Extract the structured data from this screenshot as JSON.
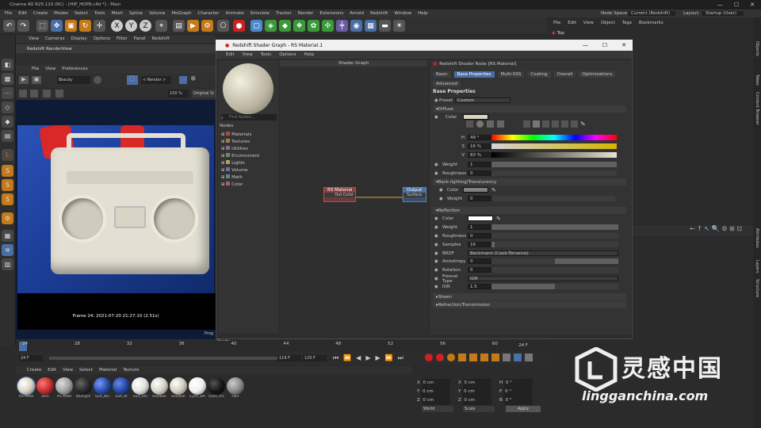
{
  "window": {
    "title": "Cinema 4D R25.110 (RC) - [HIP_HOP8.c4d *] - Main"
  },
  "menu": [
    "File",
    "Edit",
    "Create",
    "Modes",
    "Select",
    "Tools",
    "Mesh",
    "Spline",
    "Volume",
    "MoGraph",
    "Character",
    "Animate",
    "Simulate",
    "Tracker",
    "Render",
    "Extensions",
    "Arnold",
    "Redshift",
    "Window",
    "Help"
  ],
  "node_space": {
    "label": "Node Space:",
    "value": "Current (Redshift)"
  },
  "layout": {
    "label": "Layout:",
    "value": "Startup (User)"
  },
  "viewport_menu": [
    "View",
    "Cameras",
    "Display",
    "Options",
    "Filter",
    "Panel",
    "Redshift"
  ],
  "renderview": {
    "title": "Redshift RenderView",
    "menu": [
      "File",
      "View",
      "Preferences"
    ],
    "aov": "Beauty",
    "render_select": "< Render >",
    "zoom": "150 %",
    "original_size": "Original Si",
    "frame_info": "Frame  24:  2021-07-20  21:27:10  (2.51s)",
    "progress": "Prog"
  },
  "shader_graph": {
    "title": "Redshift Shader Graph - RS Material.1",
    "menu": [
      "Edit",
      "View",
      "Tools",
      "Options",
      "Help"
    ],
    "graph_title": "Shader Graph",
    "find_placeholder": "Find Nodes...",
    "nodes_label": "Nodes",
    "node_categories": [
      {
        "name": "Materials",
        "color": "#a05050"
      },
      {
        "name": "Textures",
        "color": "#a08040"
      },
      {
        "name": "Utilities",
        "color": "#8a6a9a"
      },
      {
        "name": "Environment",
        "color": "#6a8a6a"
      },
      {
        "name": "Lights",
        "color": "#b0a060"
      },
      {
        "name": "Volume",
        "color": "#7070a0"
      },
      {
        "name": "Math",
        "color": "#5a8a8a"
      },
      {
        "name": "Color",
        "color": "#a06070"
      }
    ],
    "node_rs": {
      "title": "RS Material",
      "port": "Out Color"
    },
    "node_out": {
      "title": "Output",
      "port": "Surface"
    },
    "status": "Ready"
  },
  "shader_node": {
    "title": "Redshift Shader Node [RS Material]",
    "tabs": [
      "Basic",
      "Base Properties",
      "Multi-SSS",
      "Coating",
      "Overall",
      "Optimizations",
      "Advanced"
    ],
    "active_tab": "Base Properties",
    "section_title": "Base Properties",
    "preset_label": "Preset",
    "preset_value": "Custom",
    "diffuse": "Diffuse",
    "color_label": "Color",
    "h": {
      "label": "H",
      "value": "49 °"
    },
    "s": {
      "label": "S",
      "value": "16 %"
    },
    "v": {
      "label": "V",
      "value": "83 %"
    },
    "weight": {
      "label": "Weight",
      "value": "1"
    },
    "roughness": {
      "label": "Roughness",
      "value": "0"
    },
    "backlighting": "Back-lighting/Translucency",
    "bl_color": "Color",
    "bl_weight": {
      "label": "Weight",
      "value": "0"
    },
    "reflection": "Reflection",
    "refl_color": "Color",
    "refl_weight": {
      "label": "Weight",
      "value": "1"
    },
    "refl_roughness": {
      "label": "Roughness",
      "value": "0"
    },
    "samples": {
      "label": "Samples",
      "value": "16"
    },
    "brdf": {
      "label": "BRDF",
      "value": "Beckmann (Cook-Torrance)"
    },
    "anisotropy": {
      "label": "Anisotropy",
      "value": "0"
    },
    "rotation": {
      "label": "Rotation",
      "value": "0"
    },
    "fresnel": {
      "label": "Fresnel Type",
      "value": "IOR"
    },
    "ior": {
      "label": "IOR",
      "value": "1.5"
    },
    "sheen": "Sheen",
    "refraction": "Refraction/Transmission"
  },
  "object_manager": {
    "menu": [
      "File",
      "Edit",
      "View",
      "Object",
      "Tags",
      "Bookmarks"
    ],
    "top_item": "Top"
  },
  "right_tabs": [
    "Objects",
    "Takes",
    "Content Browser",
    "Attributes",
    "Layers",
    "Structure"
  ],
  "timeline": {
    "ticks": [
      "24",
      "28",
      "32",
      "36",
      "40",
      "44",
      "48",
      "52",
      "56",
      "60"
    ],
    "current": "24 F",
    "start": "24 F",
    "end_a": "119 F",
    "end_b": "120 F",
    "right_frame": "24 F"
  },
  "material_menu": [
    "Create",
    "Edit",
    "View",
    "Select",
    "Material",
    "Texture"
  ],
  "materials": [
    {
      "name": "RS Mate",
      "color": "#d8d4c2"
    },
    {
      "name": "Skin",
      "color": "#c43030"
    },
    {
      "name": "RS Mate",
      "color": "#a0a0a0"
    },
    {
      "name": "Backgro",
      "color": "#2a2a2a"
    },
    {
      "name": "Suit_Blu",
      "color": "#2b4ea8"
    },
    {
      "name": "Suit_Bl",
      "color": "#2646a0"
    },
    {
      "name": "Suit_Stri",
      "color": "#e0e0e0"
    },
    {
      "name": "Sneaker",
      "color": "#d6d2c4"
    },
    {
      "name": "Sneaker",
      "color": "#d0ccbc"
    },
    {
      "name": "Eyes_wh",
      "color": "#f0f0f0"
    },
    {
      "name": "Eyes_iris",
      "color": "#181818"
    },
    {
      "name": "Hair",
      "color": "#8a8a8a"
    }
  ],
  "coords": {
    "x": "X",
    "y": "Y",
    "z": "Z",
    "x_val": "0 cm",
    "y_val": "0 cm",
    "z_val": "0 cm",
    "h": "H",
    "p": "P",
    "b": "B",
    "h_val": "0 °",
    "p_val": "0 °",
    "b_val": "0 °",
    "world": "World",
    "scale": "Scale",
    "apply": "Apply"
  },
  "watermark": {
    "brand": "灵感中国",
    "url": "lingganchina.com"
  }
}
